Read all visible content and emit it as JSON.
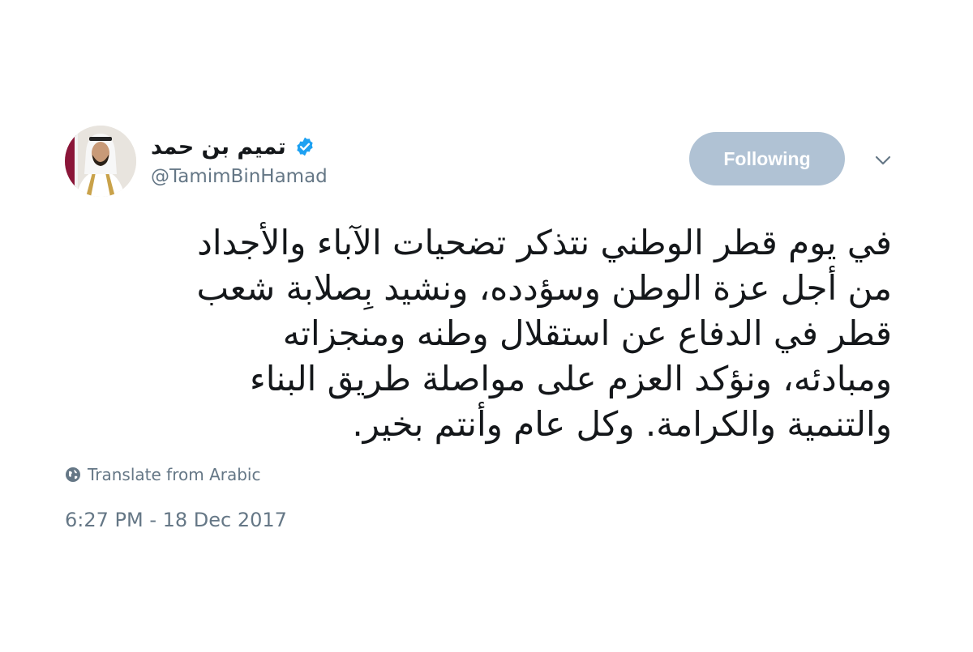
{
  "tweet": {
    "author": {
      "display_name": "تميم بن حمد",
      "handle": "@TamimBinHamad",
      "verified": true,
      "avatar_icon": "profile-photo"
    },
    "follow_button_label": "Following",
    "menu_icon": "chevron-down-icon",
    "text_lines": [
      "في يوم قطر الوطني نتذكر تضحيات الآباء والأجداد",
      "من أجل عزة الوطن وسؤدده، ونشيد بِصلابة شعب",
      "قطر في الدفاع عن استقلال وطنه ومنجزاته",
      "ومبادئه، ونؤكد العزم على مواصلة طريق البناء",
      "والتنمية والكرامة. وكل عام وأنتم بخير."
    ],
    "translate_label": "Translate from Arabic",
    "timestamp": "6:27 PM - 18 Dec 2017"
  },
  "colors": {
    "verified_badge": "#1da1f2",
    "follow_button_bg": "#b0c2d4",
    "secondary_text": "#657786",
    "primary_text": "#14171a"
  }
}
